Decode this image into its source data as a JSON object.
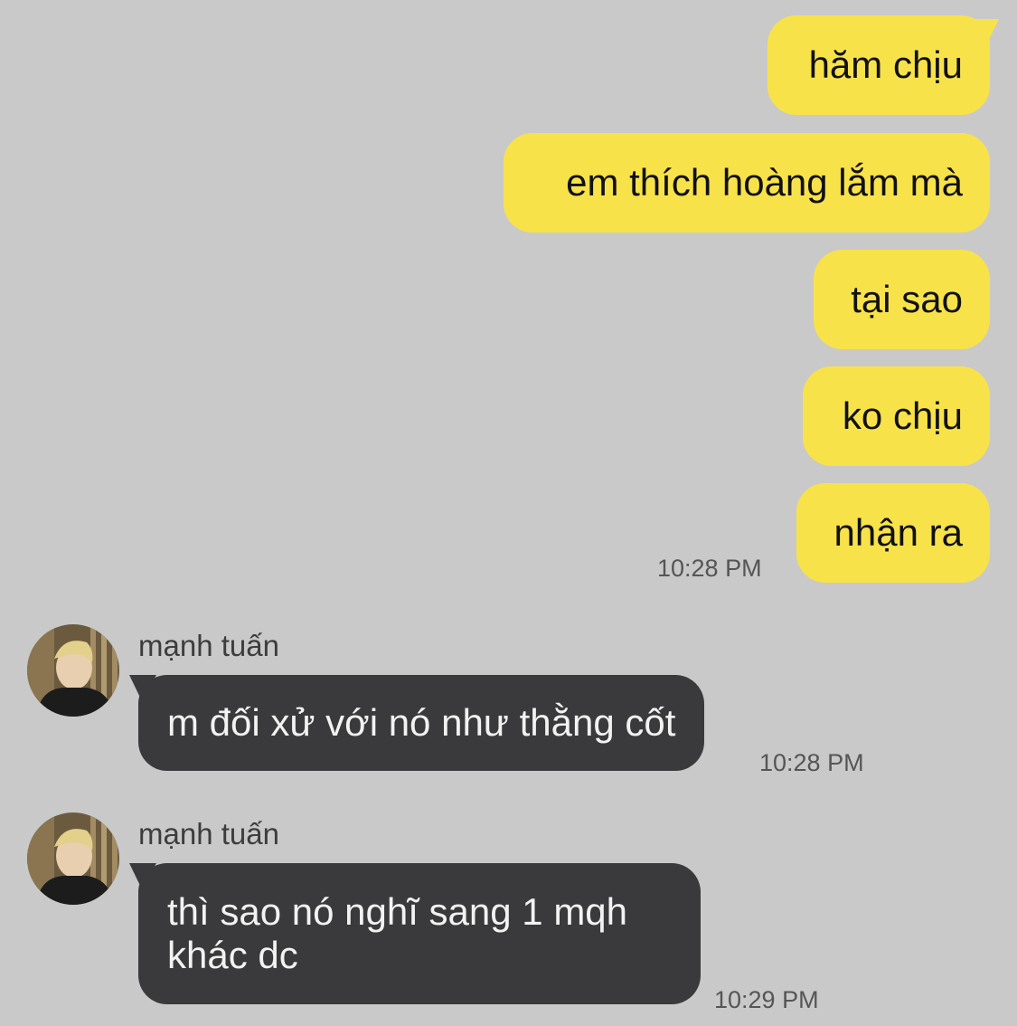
{
  "outgoing": [
    {
      "text": "hăm chịu"
    },
    {
      "text": "em thích hoàng lắm mà"
    },
    {
      "text": "tại sao"
    },
    {
      "text": "ko chịu"
    },
    {
      "text": "nhận ra"
    }
  ],
  "outgoing_time": "10:28 PM",
  "incoming": [
    {
      "sender": "mạnh tuấn",
      "text": "m đối xử với nó như thằng cốt",
      "time": "10:28 PM"
    },
    {
      "sender": "mạnh tuấn",
      "text": "thì sao nó nghĩ sang 1 mqh khác dc",
      "time": "10:29 PM"
    }
  ],
  "colors": {
    "background": "#c9c9c9",
    "outgoing_bubble": "#f8e24a",
    "incoming_bubble": "#3a3a3c"
  },
  "icons": {
    "avatar": "profile-photo"
  }
}
